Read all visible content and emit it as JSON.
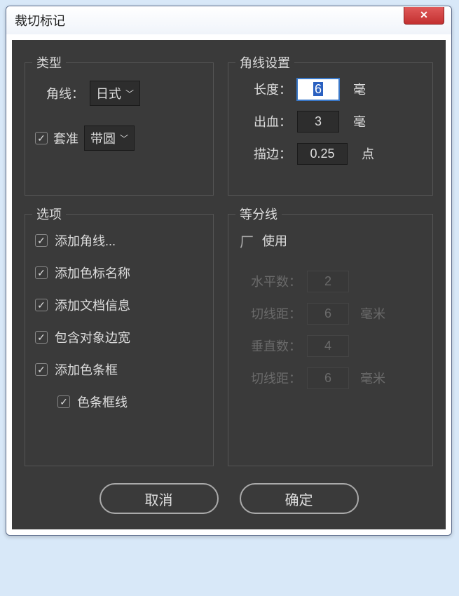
{
  "window": {
    "title": "裁切标记"
  },
  "type": {
    "legend": "类型",
    "corner_label": "角线：",
    "corner_value": "日式",
    "register_label": "套准",
    "register_checked": true,
    "register_value": "带圆"
  },
  "corner_settings": {
    "legend": "角线设置",
    "length_label": "长度：",
    "length_value": "6",
    "length_unit": "毫",
    "bleed_label": "出血：",
    "bleed_value": "3",
    "bleed_unit": "毫",
    "stroke_label": "描边：",
    "stroke_value": "0.25",
    "stroke_unit": "点"
  },
  "options": {
    "legend": "选项",
    "add_corner": "添加角线...",
    "add_swatch_names": "添加色标名称",
    "add_doc_info": "添加文档信息",
    "include_bounds": "包含对象边宽",
    "add_color_bars": "添加色条框",
    "color_bar_lines": "色条框线"
  },
  "divisions": {
    "legend": "等分线",
    "use_label": "使用",
    "use_checked": false,
    "hcount_label": "水平数：",
    "hcount_value": "2",
    "hcut_label": "切线距：",
    "hcut_value": "6",
    "hcut_unit": "毫米",
    "vcount_label": "垂直数：",
    "vcount_value": "4",
    "vcut_label": "切线距：",
    "vcut_value": "6",
    "vcut_unit": "毫米"
  },
  "buttons": {
    "cancel": "取消",
    "ok": "确定"
  }
}
